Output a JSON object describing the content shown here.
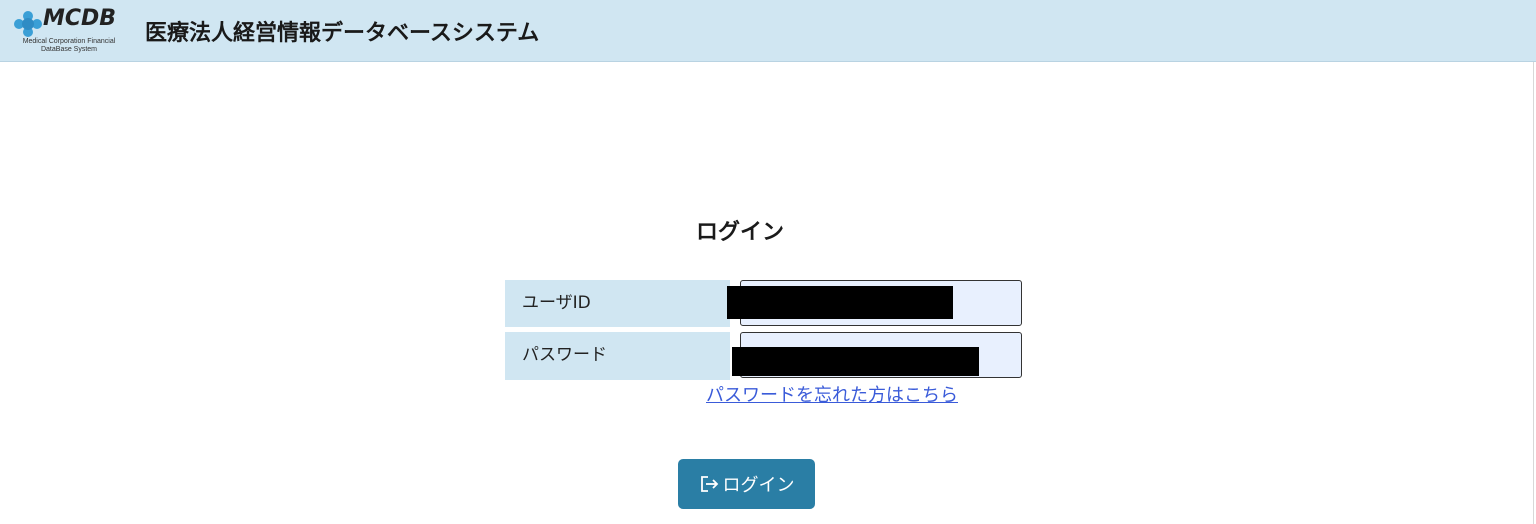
{
  "header": {
    "logo_text": "MCDB",
    "logo_sub_line1": "Medical Corporation Financial",
    "logo_sub_line2": "DataBase System",
    "title": "医療法人経営情報データベースシステム",
    "background": "#d0e6f2"
  },
  "login": {
    "title": "ログイン",
    "user_label": "ユーザID",
    "password_label": "パスワード",
    "user_value": "",
    "password_value": "",
    "forgot_link": "パスワードを忘れた方はこちら",
    "button_label": "ログイン",
    "button_icon": "sign-in-icon",
    "button_color": "#2a7ea5",
    "link_color": "#3a5bd9"
  }
}
